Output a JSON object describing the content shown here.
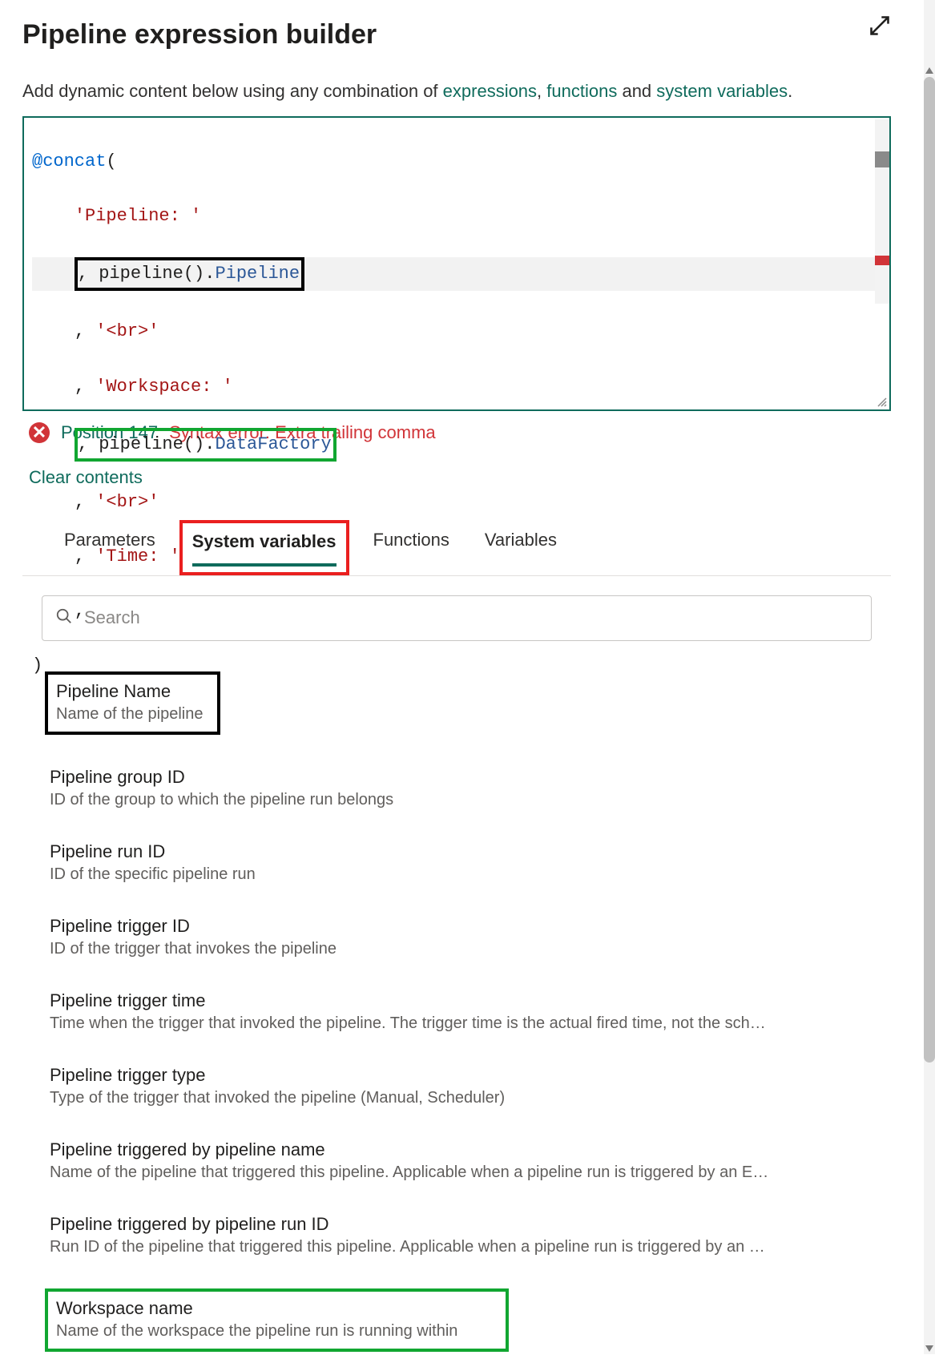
{
  "header": {
    "title": "Pipeline expression builder"
  },
  "subtitle": {
    "prefix": "Add dynamic content below using any combination of ",
    "link_expr": "expressions",
    "sep1": ", ",
    "link_func": "functions",
    "sep2": " and ",
    "link_sysvar": "system variables",
    "suffix": "."
  },
  "editor": {
    "l1_fn": "@concat",
    "l1_p": "(",
    "l2_str": "'Pipeline: '",
    "l3_c": ", ",
    "l3_call": "pipeline().",
    "l3_prop": "Pipeline",
    "l4_c": ", ",
    "l4_str": "'<br>'",
    "l5_c": ", ",
    "l5_str": "'Workspace: '",
    "l6_c": ", ",
    "l6_call": "pipeline().",
    "l6_prop": "DataFactory",
    "l7_c": ", ",
    "l7_str": "'<br>'",
    "l8_c": ", ",
    "l8_str": "'Time: '",
    "l9_c": ",",
    "l10_p": ")"
  },
  "error": {
    "position": "Position 147",
    "message": "Syntax error: Extra trailing comma"
  },
  "actions": {
    "clear": "Clear contents"
  },
  "tabs": {
    "parameters": "Parameters",
    "system_variables": "System variables",
    "functions": "Functions",
    "variables": "Variables"
  },
  "search": {
    "placeholder": "Search"
  },
  "vars": [
    {
      "title": "Pipeline Name",
      "desc": "Name of the pipeline"
    },
    {
      "title": "Pipeline group ID",
      "desc": "ID of the group to which the pipeline run belongs"
    },
    {
      "title": "Pipeline run ID",
      "desc": "ID of the specific pipeline run"
    },
    {
      "title": "Pipeline trigger ID",
      "desc": "ID of the trigger that invokes the pipeline"
    },
    {
      "title": "Pipeline trigger time",
      "desc": "Time when the trigger that invoked the pipeline. The trigger time is the actual fired time, not the sch…"
    },
    {
      "title": "Pipeline trigger type",
      "desc": "Type of the trigger that invoked the pipeline (Manual, Scheduler)"
    },
    {
      "title": "Pipeline triggered by pipeline name",
      "desc": "Name of the pipeline that triggered this pipeline. Applicable when a pipeline run is triggered by an E…"
    },
    {
      "title": "Pipeline triggered by pipeline run ID",
      "desc": "Run ID of the pipeline that triggered this pipeline. Applicable when a pipeline run is triggered by an …"
    },
    {
      "title": "Workspace name",
      "desc": "Name of the workspace the pipeline run is running within"
    }
  ]
}
